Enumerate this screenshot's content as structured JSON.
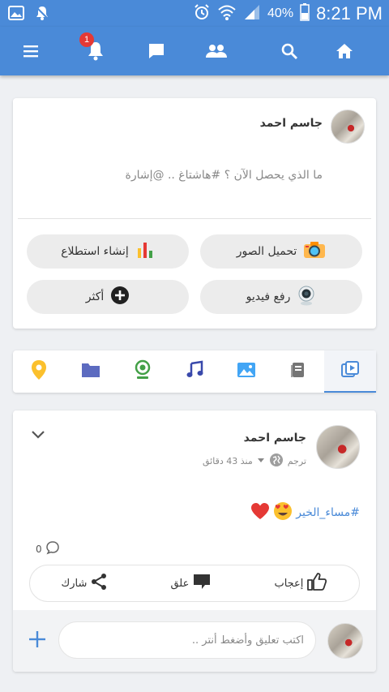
{
  "status_bar": {
    "battery_percent": "40%",
    "time": "8:21 PM"
  },
  "app_bar": {
    "notification_count": "1",
    "icons": [
      "menu-icon",
      "bell-icon",
      "chat-icon",
      "people-icon",
      "search-icon",
      "home-icon"
    ]
  },
  "composer": {
    "user_name": "جاسم احمد",
    "placeholder": "ما الذي يحصل الآن ؟ #هاشتاغ .. @إشارة",
    "actions": {
      "upload_photos": "تحميل الصور",
      "create_poll": "إنشاء استطلاع",
      "upload_video": "رفع فيديو",
      "more": "أكثر"
    }
  },
  "filter_tabs": [
    "all-posts-icon",
    "book-icon",
    "photo-icon",
    "music-icon",
    "webcam-icon",
    "folder-icon",
    "location-icon"
  ],
  "post": {
    "author": "جاسم احمد",
    "translate": "ترجم",
    "time_ago": "منذ 43 دقائق",
    "hashtag": "#مساء_الخير",
    "emojis": [
      "heart-eyes",
      "red-heart"
    ],
    "comment_count": "0",
    "like_label": "إعجاب",
    "comment_label": "علق",
    "share_label": "شارك",
    "comment_placeholder": "اكتب تعليق وأضغط أنتر .."
  },
  "colors": {
    "primary": "#4a8ad8",
    "badge": "#e53935",
    "heart": "#e53935"
  }
}
